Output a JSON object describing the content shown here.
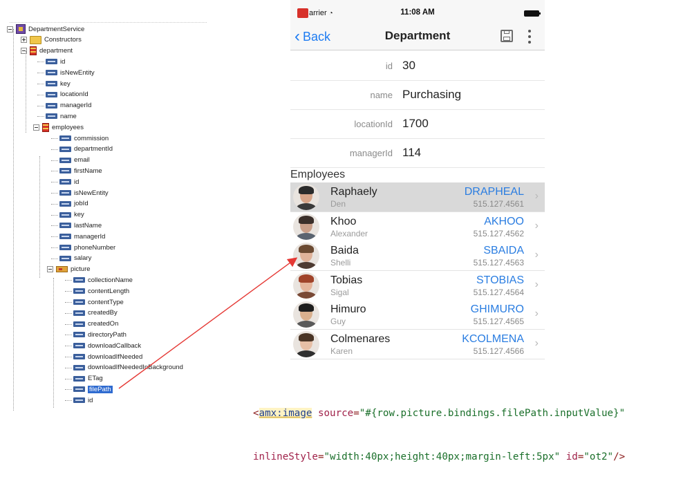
{
  "tree": {
    "nodes": [
      {
        "label": "DepartmentService",
        "icon": "service-icon",
        "expander": "minus"
      },
      {
        "label": "Constructors",
        "icon": "folder-icon",
        "expander": "plus"
      },
      {
        "label": "department",
        "icon": "collection-icon",
        "expander": "minus"
      },
      {
        "label": "id",
        "icon": "attribute-icon"
      },
      {
        "label": "isNewEntity",
        "icon": "attribute-icon"
      },
      {
        "label": "key",
        "icon": "attribute-icon"
      },
      {
        "label": "locationId",
        "icon": "attribute-icon"
      },
      {
        "label": "managerId",
        "icon": "attribute-icon"
      },
      {
        "label": "name",
        "icon": "attribute-icon"
      },
      {
        "label": "employees",
        "icon": "collection-icon",
        "expander": "minus"
      },
      {
        "label": "commission",
        "icon": "attribute-icon"
      },
      {
        "label": "departmentId",
        "icon": "attribute-icon"
      },
      {
        "label": "email",
        "icon": "attribute-icon"
      },
      {
        "label": "firstName",
        "icon": "attribute-icon"
      },
      {
        "label": "id",
        "icon": "attribute-icon"
      },
      {
        "label": "isNewEntity",
        "icon": "attribute-icon"
      },
      {
        "label": "jobId",
        "icon": "attribute-icon"
      },
      {
        "label": "key",
        "icon": "attribute-icon"
      },
      {
        "label": "lastName",
        "icon": "attribute-icon"
      },
      {
        "label": "managerId",
        "icon": "attribute-icon"
      },
      {
        "label": "phoneNumber",
        "icon": "attribute-icon"
      },
      {
        "label": "salary",
        "icon": "attribute-icon"
      },
      {
        "label": "picture",
        "icon": "object-icon",
        "expander": "minus"
      },
      {
        "label": "collectionName",
        "icon": "attribute-icon"
      },
      {
        "label": "contentLength",
        "icon": "attribute-icon"
      },
      {
        "label": "contentType",
        "icon": "attribute-icon"
      },
      {
        "label": "createdBy",
        "icon": "attribute-icon"
      },
      {
        "label": "createdOn",
        "icon": "attribute-icon"
      },
      {
        "label": "directoryPath",
        "icon": "attribute-icon"
      },
      {
        "label": "downloadCallback",
        "icon": "attribute-icon"
      },
      {
        "label": "downloadIfNeeded",
        "icon": "attribute-icon"
      },
      {
        "label": "downloadIfNeededInBackground",
        "icon": "attribute-icon"
      },
      {
        "label": "ETag",
        "icon": "attribute-icon"
      },
      {
        "label": "filePath",
        "icon": "attribute-icon",
        "selected": true
      },
      {
        "label": "id",
        "icon": "attribute-icon"
      }
    ]
  },
  "phone": {
    "status": {
      "carrier": "arrier",
      "time": "11:08 AM"
    },
    "nav": {
      "back": "Back",
      "title": "Department"
    },
    "fields": [
      {
        "label": "id",
        "value": "30"
      },
      {
        "label": "name",
        "value": "Purchasing"
      },
      {
        "label": "locationId",
        "value": "1700"
      },
      {
        "label": "managerId",
        "value": "114"
      }
    ],
    "employees_header": "Employees",
    "employees": [
      {
        "last": "Raphaely",
        "first": "Den",
        "code": "DRAPHEAL",
        "phone": "515.127.4561"
      },
      {
        "last": "Khoo",
        "first": "Alexander",
        "code": "AKHOO",
        "phone": "515.127.4562"
      },
      {
        "last": "Baida",
        "first": "Shelli",
        "code": "SBAIDA",
        "phone": "515.127.4563"
      },
      {
        "last": "Tobias",
        "first": "Sigal",
        "code": "STOBIAS",
        "phone": "515.127.4564"
      },
      {
        "last": "Himuro",
        "first": "Guy",
        "code": "GHIMURO",
        "phone": "515.127.4565"
      },
      {
        "last": "Colmenares",
        "first": "Karen",
        "code": "KCOLMENA",
        "phone": "515.127.4566"
      }
    ]
  },
  "code": {
    "line1": [
      {
        "k": "punct",
        "t": "<"
      },
      {
        "k": "tag",
        "t": "amx:image"
      },
      {
        "k": "plain",
        "t": " "
      },
      {
        "k": "attr",
        "t": "source"
      },
      {
        "k": "punct",
        "t": "="
      },
      {
        "k": "str",
        "t": "\"#{row.picture.bindings.filePath.inputValue}\""
      }
    ],
    "line2": [
      {
        "k": "attr",
        "t": "inlineStyle"
      },
      {
        "k": "punct",
        "t": "="
      },
      {
        "k": "str",
        "t": "\"width:40px;height:40px;margin-left:5px\""
      },
      {
        "k": "plain",
        "t": " "
      },
      {
        "k": "attr",
        "t": "id"
      },
      {
        "k": "punct",
        "t": "="
      },
      {
        "k": "str",
        "t": "\"ot2\""
      },
      {
        "k": "punct",
        "t": "/>"
      }
    ]
  },
  "colors": {
    "link": "#2a7de1",
    "selection": "#2f6bd0",
    "arrow": "#e53935"
  }
}
